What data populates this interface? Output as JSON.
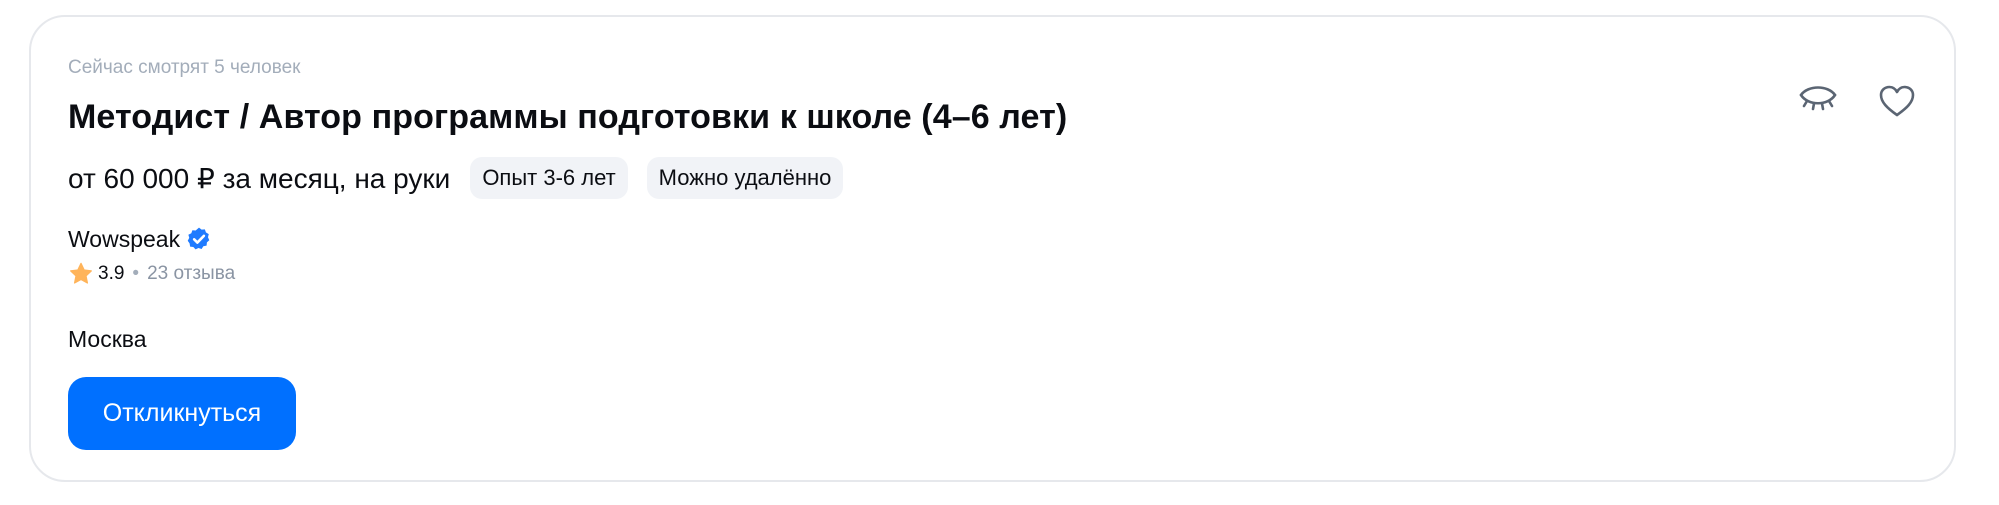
{
  "vacancy": {
    "viewers_text": "Сейчас смотрят 5 человек",
    "title": "Методист / Автор программы подготовки к школе (4–6 лет)",
    "salary": "от 60 000 ₽ за месяц, на руки",
    "tags": [
      {
        "label": "Опыт 3-6 лет"
      },
      {
        "label": "Можно удалённо"
      }
    ],
    "company": {
      "name": "Wowspeak",
      "verified_icon": "verified-badge-icon"
    },
    "rating": {
      "value": "3.9",
      "separator": "•",
      "reviews": "23 отзыва",
      "icon": "star-icon"
    },
    "city": "Москва",
    "apply_label": "Откликнуться",
    "actions": {
      "hide_icon": "eye-closed-icon",
      "favorite_icon": "heart-icon"
    }
  },
  "colors": {
    "accent": "#0070ff",
    "verified": "#1f7bff",
    "star": "#ffb45a",
    "muted_text": "#a3adba",
    "tag_bg": "#f1f3f7",
    "border": "#e6e8ec"
  }
}
